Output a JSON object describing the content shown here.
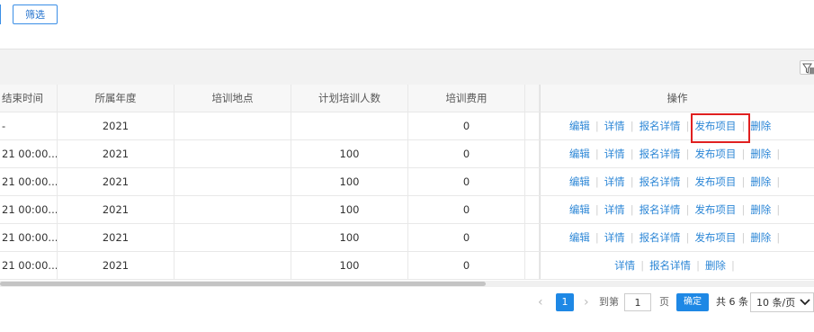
{
  "toolbar": {
    "filter_label": "筛选"
  },
  "table": {
    "headers": {
      "end_time": "结束时间",
      "year": "所属年度",
      "location": "培训地点",
      "planned_count": "计划培训人数",
      "fee": "培训费用",
      "actions": "操作"
    },
    "rows": [
      {
        "end_time": "-",
        "year": "2021",
        "location": "",
        "planned_count": "",
        "fee": "0"
      },
      {
        "end_time": "21 00:00...",
        "year": "2021",
        "location": "",
        "planned_count": "100",
        "fee": "0"
      },
      {
        "end_time": "21 00:00...",
        "year": "2021",
        "location": "",
        "planned_count": "100",
        "fee": "0"
      },
      {
        "end_time": "21 00:00...",
        "year": "2021",
        "location": "",
        "planned_count": "100",
        "fee": "0"
      },
      {
        "end_time": "21 00:00...",
        "year": "2021",
        "location": "",
        "planned_count": "100",
        "fee": "0"
      },
      {
        "end_time": "21 00:00...",
        "year": "2021",
        "location": "",
        "planned_count": "100",
        "fee": "0"
      }
    ],
    "actions": {
      "edit": "编辑",
      "detail": "详情",
      "signup_detail": "报名详情",
      "publish": "发布项目",
      "delete": "删除"
    }
  },
  "pagination": {
    "prev": "‹",
    "current_page": "1",
    "next": "›",
    "goto_label": "到第",
    "goto_value": "1",
    "page_unit": "页",
    "confirm": "确定",
    "total": "共 6 条",
    "page_size": "10 条/页"
  },
  "icons": {
    "column_filter": "column-filter-icon",
    "dropdown": "chevron-down-icon"
  },
  "colors": {
    "link": "#2b86d6",
    "primary": "#1e88e5",
    "highlight": "#e02020"
  }
}
